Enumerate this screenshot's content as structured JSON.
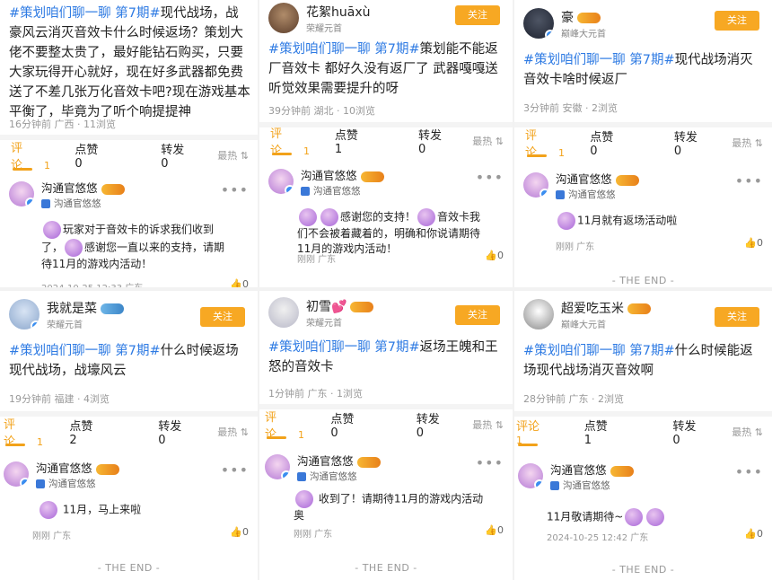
{
  "ui": {
    "follow": "关注",
    "comment": "评论",
    "like": "点赞",
    "repost": "转发",
    "sort": "最热 ⇅",
    "end": "- THE END -",
    "dots": "•••",
    "likeicon": "👍"
  },
  "tag": "#策划咱们聊一聊 第7期#",
  "official": {
    "name": "沟通官悠悠",
    "tag": "沟通官悠悠"
  },
  "posts": [
    {
      "user": "",
      "sub": "",
      "body": "现代战场，战豪风云消灭音效卡什么时候返场？策划大佬不要整太贵了，最好能钻石购买，只要大家玩得开心就好，现在好多武器都免费送了不差几张万化音效卡吧?现在游戏基本平衡了，毕竟为了听个响提提神",
      "meta": "16分钟前 广西 · 11浏览",
      "comments": "1",
      "likes": "0",
      "reposts": "0",
      "reply_a": "玩家对于音效卡的诉求我们收到了，",
      "reply_b": "感谢您一直以来的支持，请期待11月的游戏内活动！",
      "rtime": "2024-10-25 12:33 广东",
      "rlike": "0"
    },
    {
      "user": "花絮huāxù",
      "sub": "荣耀元首",
      "body": "策划能不能返厂音效卡 都好久没有返厂了 武器嘎嘎送 听觉效果需要提升的呀",
      "meta": "39分钟前 湖北 · 10浏览",
      "comments": "1",
      "likes": "1",
      "reposts": "0",
      "reply_a": "感谢您的支持！",
      "reply_b": "音效卡我们不会被着藏着的，明确和你说请期待11月的游戏内活动！",
      "rtime": "刚刚 广东",
      "rlike": "0"
    },
    {
      "user": "豪",
      "sub": "巅峰大元首",
      "body": "现代战场消灭音效卡啥时候返厂",
      "meta": "3分钟前 安徽 · 2浏览",
      "comments": "1",
      "likes": "0",
      "reposts": "0",
      "reply_a": "11月就有返场活动啦",
      "reply_b": "",
      "rtime": "刚刚 广东",
      "rlike": "0"
    },
    {
      "user": "我就是菜",
      "sub": "荣耀元首",
      "body": "什么时候返场现代战场，战壕风云",
      "meta": "19分钟前 福建 · 4浏览",
      "comments": "1",
      "likes": "2",
      "reposts": "0",
      "reply_a": "11月，马上来啦",
      "reply_b": "",
      "rtime": "刚刚 广东",
      "rlike": "0"
    },
    {
      "user": "初雪💕",
      "sub": "荣耀元首",
      "body": "返场王魄和王怒的音效卡",
      "meta": "1分钟前 广东 · 1浏览",
      "comments": "1",
      "likes": "0",
      "reposts": "0",
      "reply_a": "收到了！请期待11月的游戏内活动",
      "reply_b": "奥",
      "rtime": "刚刚 广东",
      "rlike": "0"
    },
    {
      "user": "超爱吃玉米",
      "sub": "巅峰大元首",
      "body": "什么时候能返场现代战场消灭音效啊",
      "meta": "28分钟前 广东 · 2浏览",
      "comments": "1",
      "likes": "1",
      "reposts": "0",
      "reply_a": "11月敬请期待~",
      "reply_b": "",
      "rtime": "2024-10-25 12:42 广东",
      "rlike": "0"
    }
  ],
  "colors": {
    "accent": "#f2a21a",
    "tag": "#2f7be3",
    "follow": "#f7a823"
  }
}
